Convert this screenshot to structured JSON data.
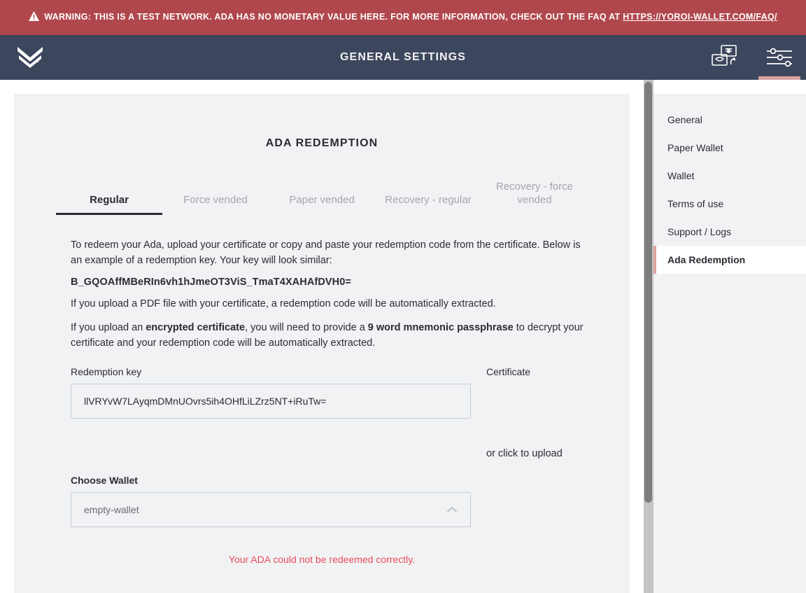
{
  "warning": {
    "icon": "warning-triangle-icon",
    "text": "WARNING: THIS IS A TEST NETWORK. ADA HAS NO MONETARY VALUE HERE. FOR MORE INFORMATION, CHECK OUT THE FAQ AT ",
    "link_text": "HTTPS://YOROI-WALLET.COM/FAQ/",
    "bg_color": "#b0474d"
  },
  "topbar": {
    "logo": "yoroi-logo-icon",
    "title": "GENERAL SETTINGS",
    "bg_color": "#3c465c",
    "wallet_switch_icon": "wallet-switch-icon",
    "settings_icon": "settings-sliders-icon",
    "active_indicator_color": "#dba2a0"
  },
  "content": {
    "title": "ADA REDEMPTION",
    "tabs": [
      {
        "label": "Regular",
        "active": true
      },
      {
        "label": "Force vended",
        "active": false
      },
      {
        "label": "Paper vended",
        "active": false
      },
      {
        "label": "Recovery - regular",
        "active": false
      },
      {
        "label": "Recovery - force vended",
        "active": false
      }
    ],
    "paragraph_1": "To redeem your Ada, upload your certificate or copy and paste your redemption code from the certificate. Below is an example of a redemption key. Your key will look similar:",
    "key_sample": "B_GQOAffMBeRIn6vh1hJmeOT3ViS_TmaT4XAHAfDVH0=",
    "paragraph_2": "If you upload a PDF file with your certificate, a redemption code will be automatically extracted.",
    "paragraph_3_a": "If you upload an ",
    "paragraph_3_b": "encrypted certificate",
    "paragraph_3_c": ", you will need to provide a ",
    "paragraph_3_d": "9 word mnemonic passphrase",
    "paragraph_3_e": " to decrypt your certificate and your redemption code will be automatically extracted.",
    "form": {
      "redemption_key_label": "Redemption key",
      "redemption_key_value": "llVRYvW7LAyqmDMnUOvrs5ih4OHfLiLZrz5NT+iRuTw=",
      "redemption_key_placeholder": "Redemption key",
      "certificate_label": "Certificate",
      "upload_hint": "or click to upload",
      "choose_wallet_label": "Choose Wallet",
      "choose_wallet_value": "empty-wallet",
      "choose_wallet_caret": "chevron-up-icon",
      "error_message": "Your ADA could not be redeemed correctly.",
      "error_color": "#ea4c5b"
    }
  },
  "settings_menu": {
    "items": [
      {
        "label": "General",
        "active": false
      },
      {
        "label": "Paper Wallet",
        "active": false
      },
      {
        "label": "Wallet",
        "active": false
      },
      {
        "label": "Terms of use",
        "active": false
      },
      {
        "label": "Support / Logs",
        "active": false
      },
      {
        "label": "Ada Redemption",
        "active": true
      }
    ]
  }
}
